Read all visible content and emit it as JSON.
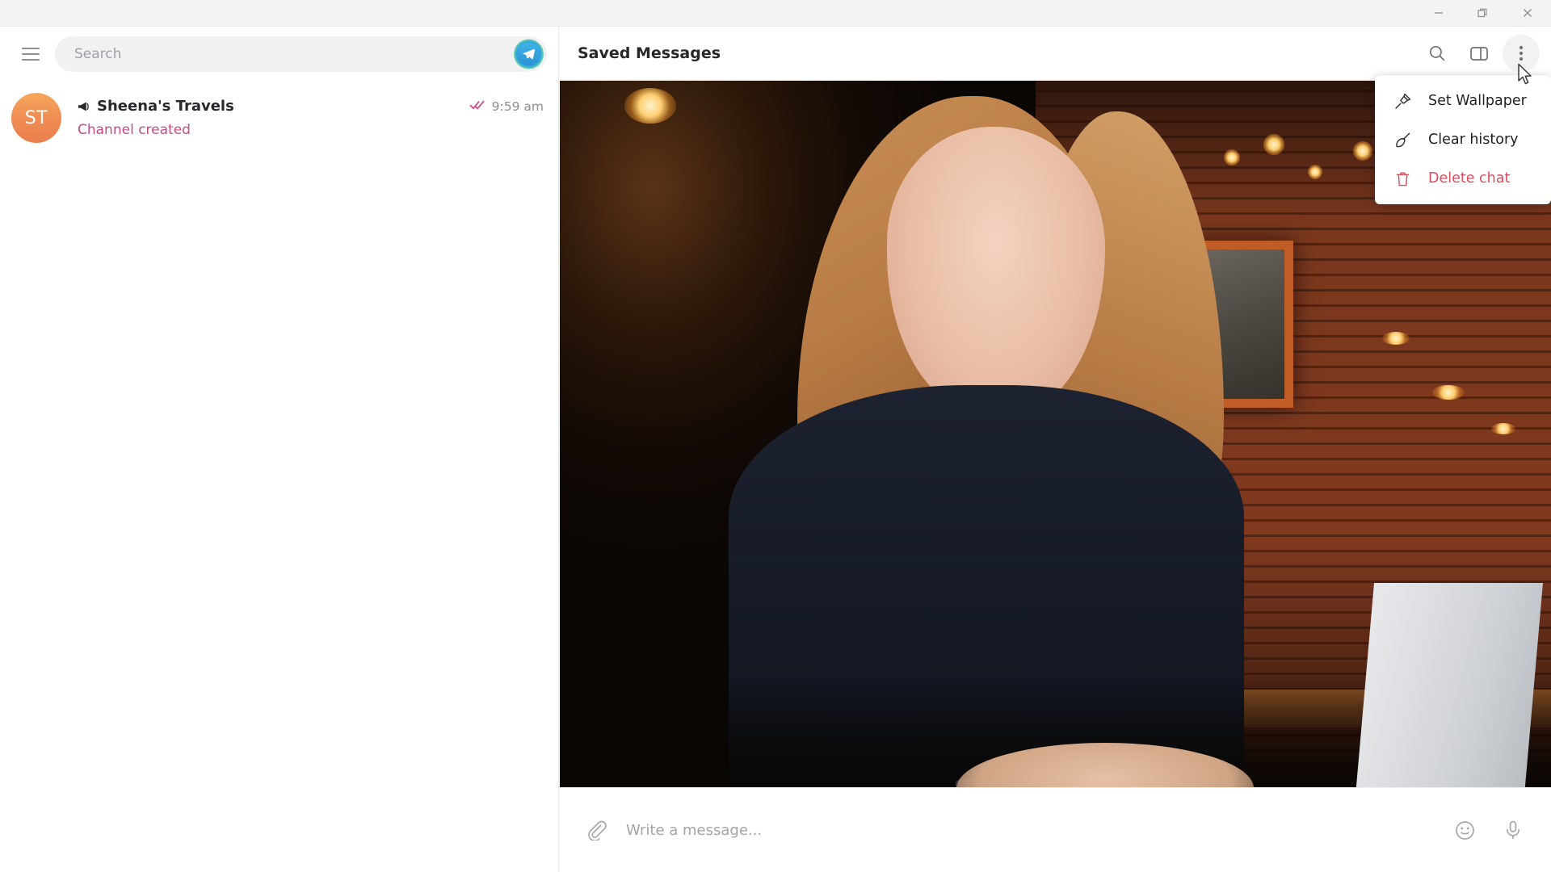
{
  "window": {
    "minimize_label": "Minimize",
    "restore_label": "Restore",
    "close_label": "Close"
  },
  "sidebar": {
    "menu_icon": "hamburger-icon",
    "search": {
      "placeholder": "Search",
      "value": ""
    },
    "logo_button": "telegram-logo-button",
    "chats": [
      {
        "avatar_initials": "ST",
        "avatar_color": "#ef8b52",
        "badge_icon": "megaphone-icon",
        "title": "Sheena's Travels",
        "preview": "Channel created",
        "preview_color": "#c44a8c",
        "time": "9:59 am",
        "status_icon": "double-check-icon",
        "status_color": "#d24b8e"
      }
    ]
  },
  "chat": {
    "title": "Saved Messages",
    "actions": [
      {
        "name": "search-icon",
        "label": "Search"
      },
      {
        "name": "panel-toggle-icon",
        "label": "Toggle info panel"
      },
      {
        "name": "more-options-icon",
        "label": "More"
      }
    ],
    "media": {
      "type": "photo",
      "description": "Smiling woman with long reddish-blonde hair in a dark cafe, holding a phone beside a laptop"
    },
    "composer": {
      "attach_icon": "paperclip-icon",
      "placeholder": "Write a message...",
      "value": "",
      "emoji_icon": "emoji-icon",
      "mic_icon": "microphone-icon"
    }
  },
  "context_menu": {
    "visible": true,
    "items": [
      {
        "icon": "wallpaper-pin-icon",
        "label": "Set Wallpaper",
        "danger": false
      },
      {
        "icon": "broom-icon",
        "label": "Clear history",
        "danger": false
      },
      {
        "icon": "trash-icon",
        "label": "Delete chat",
        "danger": true
      }
    ],
    "danger_color": "#d94c5c"
  }
}
